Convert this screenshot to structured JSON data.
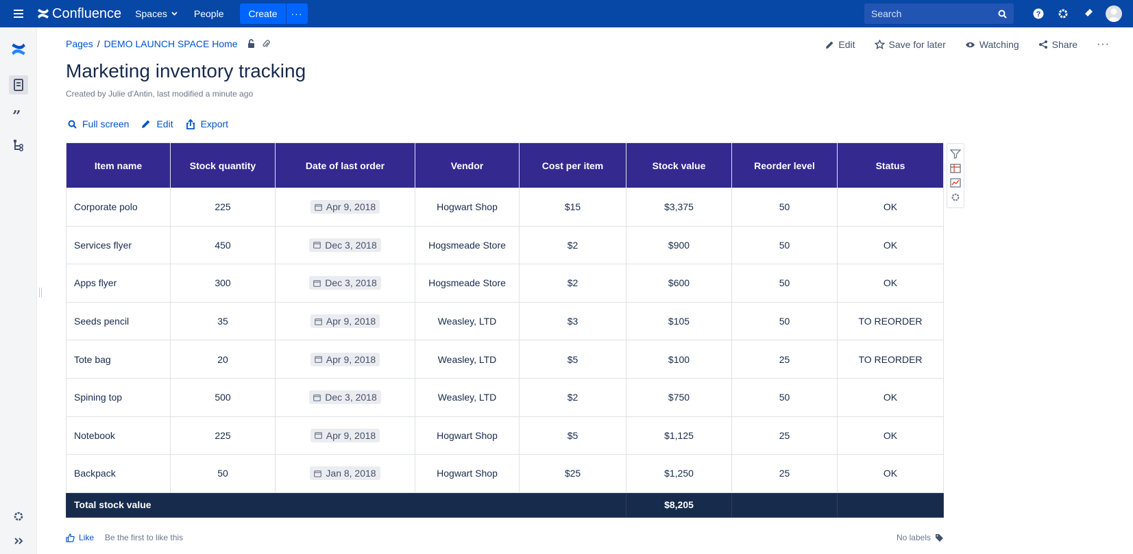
{
  "app": {
    "name": "Confluence",
    "nav": {
      "spaces_label": "Spaces",
      "people_label": "People",
      "create_label": "Create",
      "more_label": "···",
      "search_placeholder": "Search"
    }
  },
  "breadcrumb": {
    "root": "Pages",
    "separator": "/",
    "space": "DEMO LAUNCH SPACE Home"
  },
  "page_actions": {
    "edit": "Edit",
    "save_for_later": "Save for later",
    "watching": "Watching",
    "share": "Share",
    "more": "···"
  },
  "page": {
    "title": "Marketing inventory tracking",
    "meta": "Created by Julie d'Antin, last modified a minute ago"
  },
  "table_tools": {
    "full_screen": "Full screen",
    "edit": "Edit",
    "export": "Export"
  },
  "table": {
    "columns": [
      "Item name",
      "Stock quantity",
      "Date of last order",
      "Vendor",
      "Cost per item",
      "Stock value",
      "Reorder level",
      "Status"
    ],
    "rows": [
      [
        "Corporate polo",
        "225",
        "Apr 9, 2018",
        "Hogwart Shop",
        "$15",
        "$3,375",
        "50",
        "OK"
      ],
      [
        "Services flyer",
        "450",
        "Dec 3, 2018",
        "Hogsmeade Store",
        "$2",
        "$900",
        "50",
        "OK"
      ],
      [
        "Apps flyer",
        "300",
        "Dec 3, 2018",
        "Hogsmeade Store",
        "$2",
        "$600",
        "50",
        "OK"
      ],
      [
        "Seeds pencil",
        "35",
        "Apr 9, 2018",
        "Weasley, LTD",
        "$3",
        "$105",
        "50",
        "TO REORDER"
      ],
      [
        "Tote bag",
        "20",
        "Apr 9, 2018",
        "Weasley, LTD",
        "$5",
        "$100",
        "25",
        "TO REORDER"
      ],
      [
        "Spining top",
        "500",
        "Dec 3, 2018",
        "Weasley, LTD",
        "$2",
        "$750",
        "50",
        "OK"
      ],
      [
        "Notebook",
        "225",
        "Apr 9, 2018",
        "Hogwart Shop",
        "$5",
        "$1,125",
        "25",
        "OK"
      ],
      [
        "Backpack",
        "50",
        "Jan 8, 2018",
        "Hogwart Shop",
        "$25",
        "$1,250",
        "25",
        "OK"
      ]
    ],
    "total_label": "Total stock value",
    "total_value": "$8,205"
  },
  "footer": {
    "like": "Like",
    "like_prompt": "Be the first to like this",
    "labels": "No labels"
  },
  "colors": {
    "top_nav": "#0747a6",
    "create_button": "#0065ff",
    "header_row": "#33298f",
    "total_row": "#172b4d",
    "link": "#0052cc"
  }
}
